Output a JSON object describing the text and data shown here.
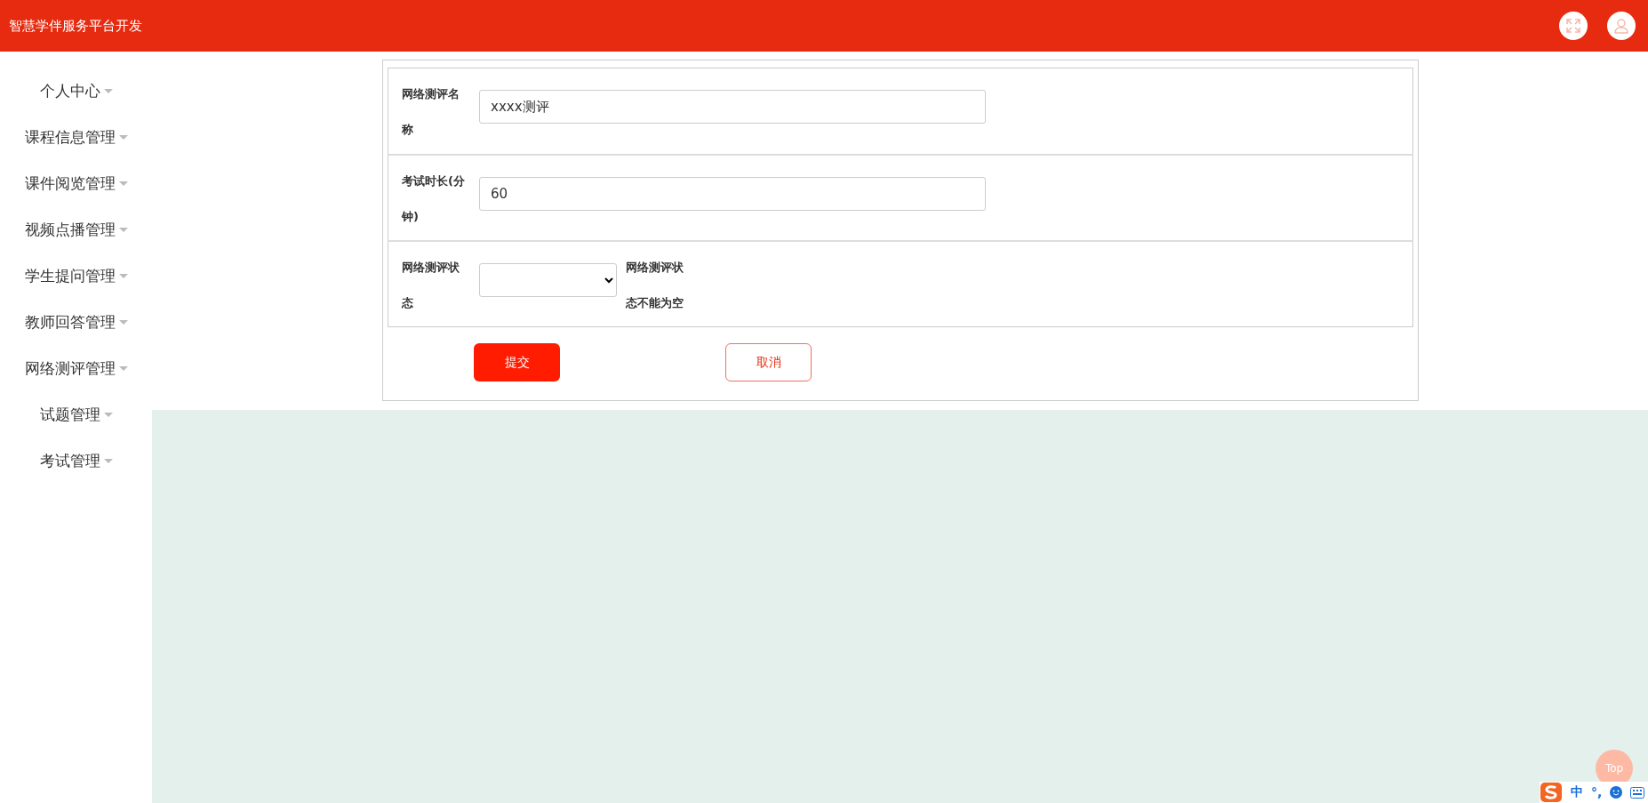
{
  "header": {
    "title": "智慧学伴服务平台开发"
  },
  "sidebar": {
    "items": [
      {
        "label": "个人中心"
      },
      {
        "label": "课程信息管理"
      },
      {
        "label": "课件阅览管理"
      },
      {
        "label": "视频点播管理"
      },
      {
        "label": "学生提问管理"
      },
      {
        "label": "教师回答管理"
      },
      {
        "label": "网络测评管理"
      },
      {
        "label": "试题管理"
      },
      {
        "label": "考试管理"
      }
    ]
  },
  "form": {
    "fields": [
      {
        "kind": "input",
        "label": "网络测评名称",
        "value": "xxxx测评"
      },
      {
        "kind": "input",
        "label": "考试时长(分钟)",
        "value": "60"
      },
      {
        "kind": "select",
        "label": "网络测评状态",
        "error": "网络测评状态不能为空"
      }
    ],
    "buttons": [
      {
        "kind": "primary",
        "label": "提交"
      },
      {
        "kind": "outline",
        "label": "取消"
      }
    ]
  },
  "back_to_top": "Top",
  "ime_toolbar": {
    "mode": "中",
    "punctuation": "°,"
  }
}
